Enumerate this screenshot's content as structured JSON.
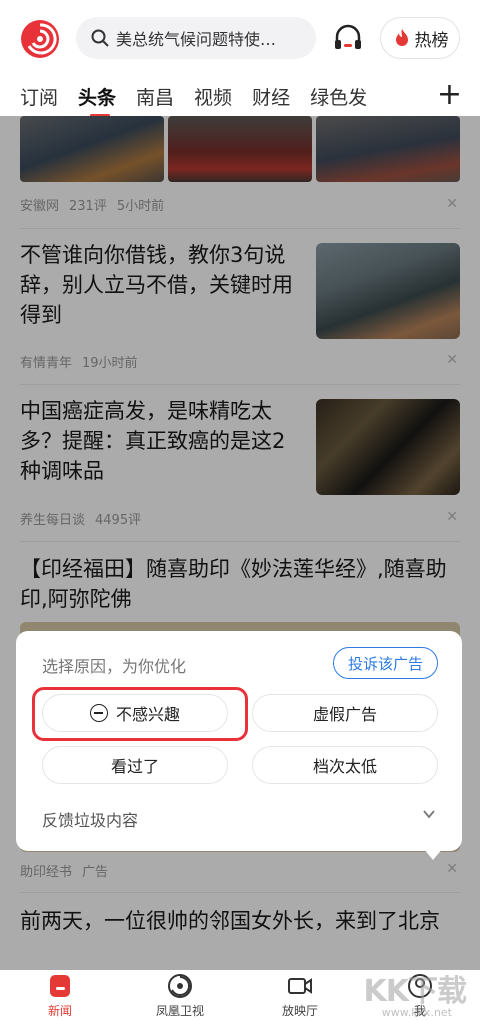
{
  "header": {
    "search_text": "美总统气候问题特使…",
    "hot_label": "热榜"
  },
  "tabs": [
    "订阅",
    "头条",
    "南昌",
    "视频",
    "财经",
    "绿色发"
  ],
  "feed": {
    "item0": {
      "source": "安徽网",
      "comments": "231评",
      "time": "5小时前"
    },
    "item1": {
      "title": "不管谁向你借钱，教你3句说辞，别人立马不借，关键时用得到",
      "source": "有情青年",
      "time": "19小时前"
    },
    "item2": {
      "title": "中国癌症高发，是味精吃太多？提醒：真正致癌的是这2种调味品",
      "source": "养生每日谈",
      "comments": "4495评"
    },
    "item3": {
      "title": "【印经福田】随喜助印《妙法莲华经》,随喜助印,阿弥陀佛",
      "source": "助印经书",
      "tag": "广告"
    },
    "item4": {
      "title": "前两天，一位很帅的邻国女外长，来到了北京"
    }
  },
  "popup": {
    "prompt": "选择原因，为你优化",
    "report_label": "投诉该广告",
    "reasons": [
      "不感兴趣",
      "虚假广告",
      "看过了",
      "档次太低"
    ],
    "feedback_label": "反馈垃圾内容"
  },
  "bottom_nav": [
    "新闻",
    "凤凰卫视",
    "放映厅",
    "我"
  ],
  "watermark": {
    "main": "KK下载",
    "sub": "www.kkx.net"
  },
  "colors": {
    "accent": "#e53935",
    "link_blue": "#2d7be5",
    "highlight": "#e8323a"
  }
}
